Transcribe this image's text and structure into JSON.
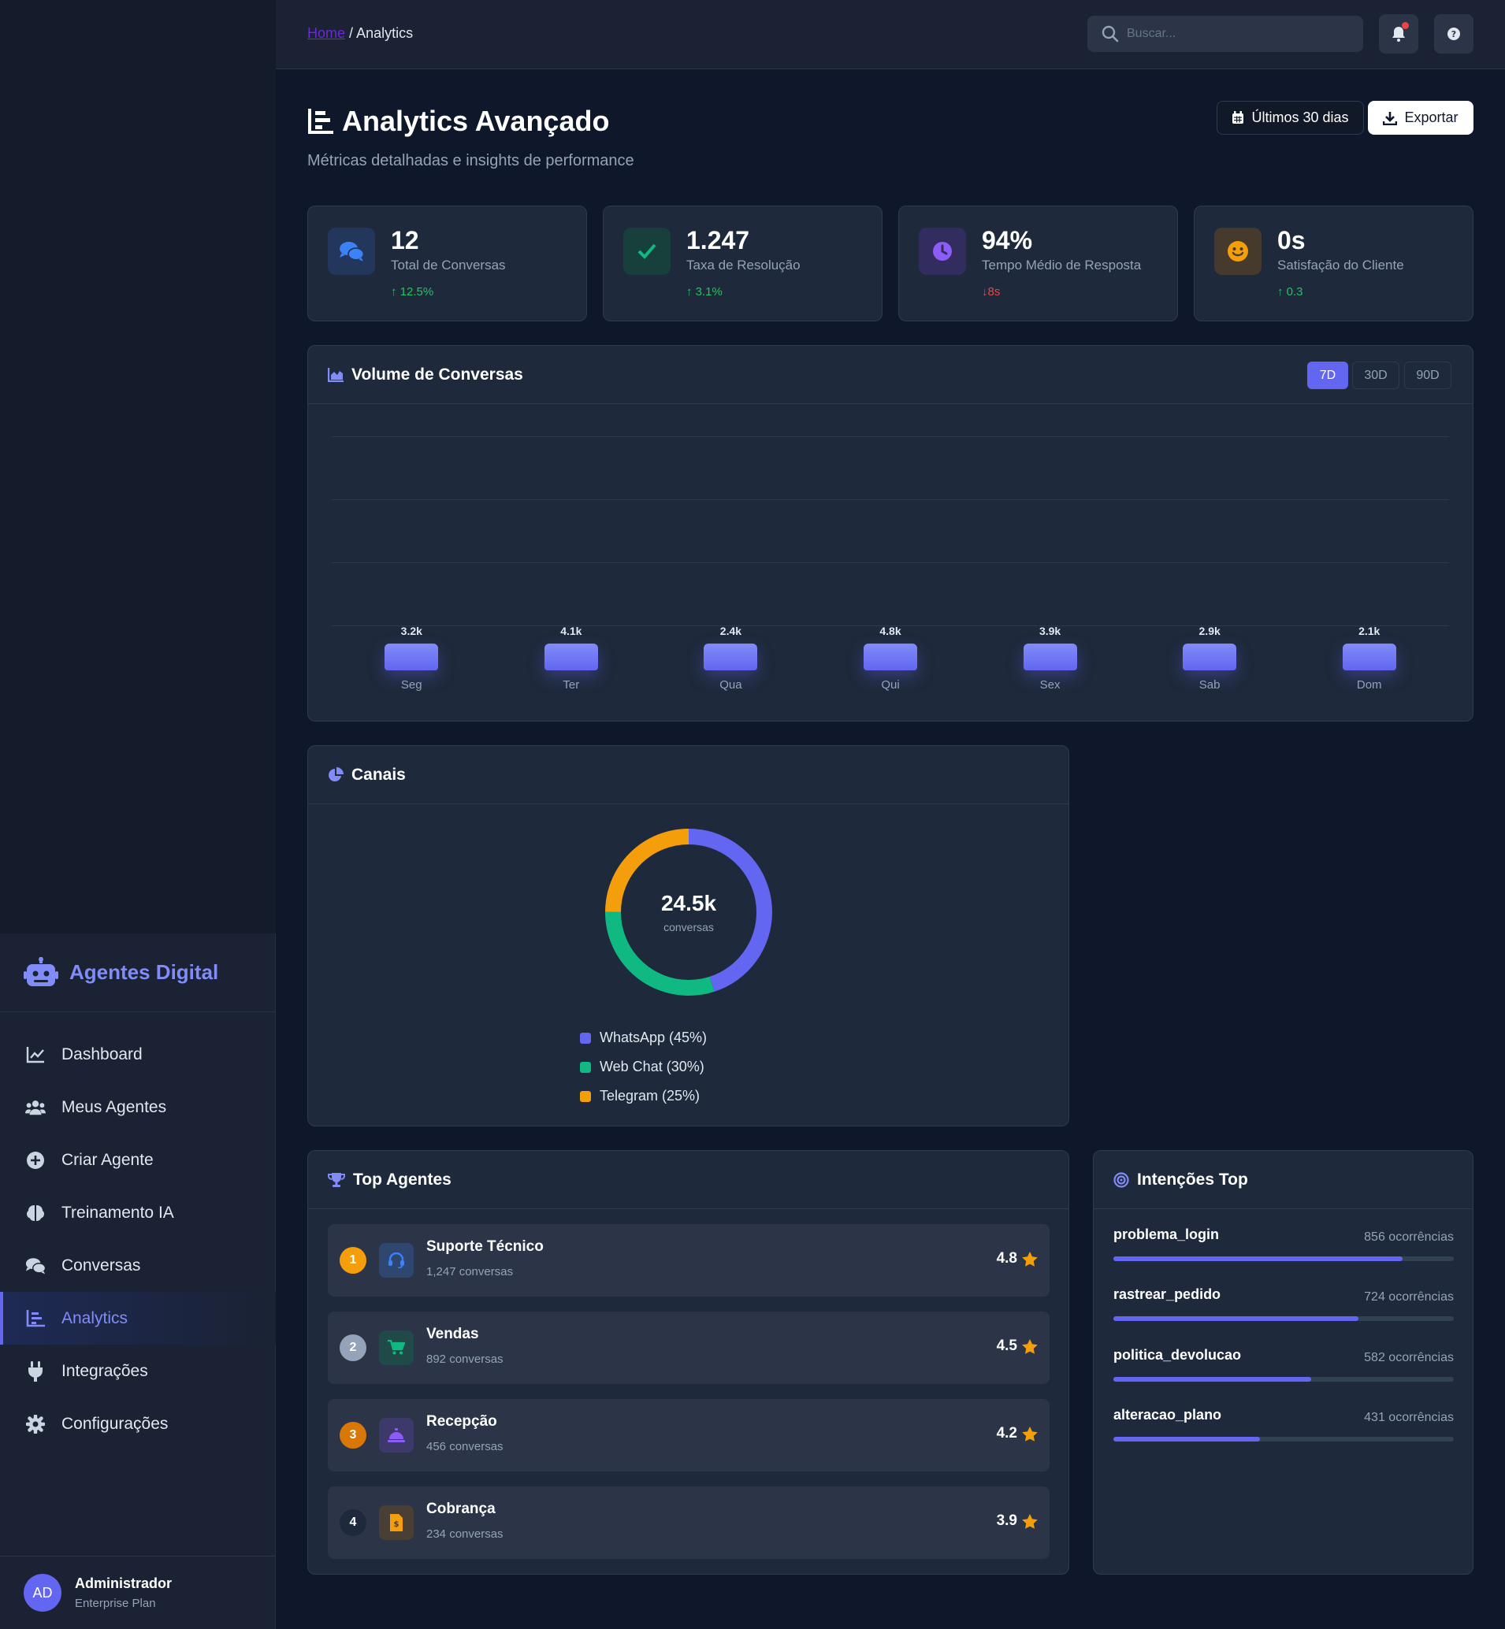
{
  "app": {
    "name": "Agentes Digital"
  },
  "breadcrumb": {
    "home": "Home",
    "sep": "/",
    "current": "Analytics"
  },
  "search": {
    "placeholder": "Buscar..."
  },
  "header": {
    "title": "Analytics Avançado",
    "subtitle": "Métricas detalhadas e insights de performance",
    "range_label": "Últimos 30 dias",
    "export_label": "Exportar"
  },
  "nav": [
    {
      "label": "Dashboard",
      "icon": "chart-line-icon"
    },
    {
      "label": "Meus Agentes",
      "icon": "users-icon"
    },
    {
      "label": "Criar Agente",
      "icon": "plus-circle-icon"
    },
    {
      "label": "Treinamento IA",
      "icon": "brain-icon"
    },
    {
      "label": "Conversas",
      "icon": "comments-icon"
    },
    {
      "label": "Analytics",
      "icon": "chart-bar-icon",
      "active": true
    },
    {
      "label": "Integrações",
      "icon": "plug-icon"
    },
    {
      "label": "Configurações",
      "icon": "gear-icon"
    }
  ],
  "user": {
    "initials": "AD",
    "name": "Administrador",
    "plan": "Enterprise Plan"
  },
  "stats": [
    {
      "value": "12",
      "label": "Total de Conversas",
      "change": "12.5%",
      "trend": "up",
      "icon": "comments-icon",
      "color": "#3b82f6"
    },
    {
      "value": "1.247",
      "label": "Taxa de Resolução",
      "change": "3.1%",
      "trend": "up",
      "icon": "check-icon",
      "color": "#10b981"
    },
    {
      "value": "94%",
      "label": "Tempo Médio de Resposta",
      "change": "8s",
      "trend": "down",
      "icon": "clock-icon",
      "color": "#8b5cf6"
    },
    {
      "value": "0s",
      "label": "Satisfação do Cliente",
      "change": "0.3",
      "trend": "up",
      "icon": "smile-icon",
      "color": "#f59e0b"
    }
  ],
  "volume": {
    "title": "Volume de Conversas",
    "periods": [
      "7D",
      "30D",
      "90D"
    ],
    "active_period": "7D"
  },
  "chart_data": {
    "type": "bar",
    "categories": [
      "Seg",
      "Ter",
      "Qua",
      "Qui",
      "Sex",
      "Sab",
      "Dom"
    ],
    "values": [
      3200,
      4100,
      2400,
      4800,
      3900,
      2900,
      2100
    ],
    "value_labels": [
      "3.2k",
      "4.1k",
      "2.4k",
      "4.8k",
      "3.9k",
      "2.9k",
      "2.1k"
    ],
    "grid": true
  },
  "channels": {
    "title": "Canais",
    "total": "24.5k",
    "total_label": "conversas",
    "items": [
      {
        "label": "WhatsApp (45%)",
        "pct": 45,
        "color": "#6366f1"
      },
      {
        "label": "Web Chat (30%)",
        "pct": 30,
        "color": "#10b981"
      },
      {
        "label": "Telegram (25%)",
        "pct": 25,
        "color": "#f59e0b"
      }
    ]
  },
  "top_agents": {
    "title": "Top Agentes",
    "items": [
      {
        "rank": "1",
        "name": "Suporte Técnico",
        "conversations": "1,247 conversas",
        "rating": "4.8",
        "rank_color": "#f59e0b",
        "icon": "headset-icon",
        "icon_color": "#3b82f6"
      },
      {
        "rank": "2",
        "name": "Vendas",
        "conversations": "892 conversas",
        "rating": "4.5",
        "rank_color": "#94a3b8",
        "icon": "cart-icon",
        "icon_color": "#10b981"
      },
      {
        "rank": "3",
        "name": "Recepção",
        "conversations": "456 conversas",
        "rating": "4.2",
        "rank_color": "#d97706",
        "icon": "bell-concierge-icon",
        "icon_color": "#8b5cf6"
      },
      {
        "rank": "4",
        "name": "Cobrança",
        "conversations": "234 conversas",
        "rating": "3.9",
        "rank_color": "#1e293b",
        "icon": "invoice-icon",
        "icon_color": "#f59e0b"
      }
    ]
  },
  "intents": {
    "title": "Intenções Top",
    "items": [
      {
        "name": "problema_login",
        "count": "856 ocorrências",
        "fill": 0.85
      },
      {
        "name": "rastrear_pedido",
        "count": "724 ocorrências",
        "fill": 0.72
      },
      {
        "name": "politica_devolucao",
        "count": "582 ocorrências",
        "fill": 0.58
      },
      {
        "name": "alteracao_plano",
        "count": "431 ocorrências",
        "fill": 0.43
      }
    ]
  }
}
